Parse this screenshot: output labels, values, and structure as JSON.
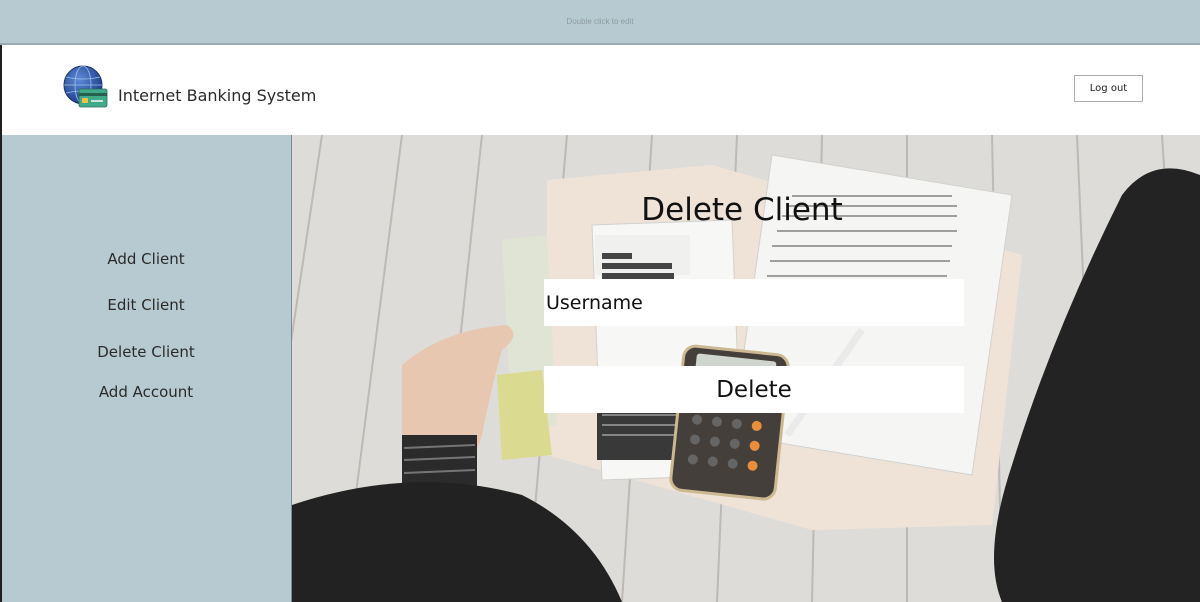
{
  "titlebar": {
    "hint": "Double click to edit"
  },
  "header": {
    "app_title": "Internet Banking System",
    "logout_label": "Log out"
  },
  "sidebar": {
    "items": [
      {
        "label": "Add Client"
      },
      {
        "label": "Edit Client"
      },
      {
        "label": "Delete Client"
      },
      {
        "label": "Add Account"
      }
    ]
  },
  "main": {
    "title": "Delete Client",
    "username": {
      "placeholder": "Username",
      "value": ""
    },
    "delete_label": "Delete"
  },
  "colors": {
    "sidebar_bg": "#b8cad1",
    "titlebar_bg": "#b8cad1",
    "panel_white": "#ffffff"
  },
  "icons": {
    "logo": "globe-card-logo-icon"
  }
}
